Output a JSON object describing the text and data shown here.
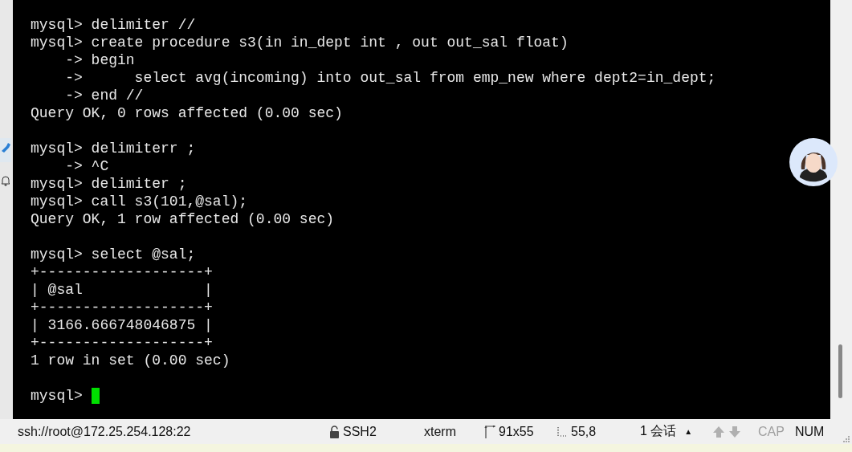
{
  "terminal": {
    "blocks": [
      {
        "lines": [
          "mysql> delimiter //",
          "mysql> create procedure s3(in in_dept int , out out_sal float)",
          "    -> begin",
          "    ->      select avg(incoming) into out_sal from emp_new where dept2=in_dept;",
          "    -> end //",
          "Query OK, 0 rows affected (0.00 sec)"
        ]
      },
      {
        "lines": [
          "mysql> delimiterr ;",
          "    -> ^C",
          "mysql> delimiter ;",
          "mysql> call s3(101,@sal);",
          "Query OK, 1 row affected (0.00 sec)"
        ]
      },
      {
        "lines": [
          "mysql> select @sal;",
          "+-------------------+",
          "| @sal              |",
          "+-------------------+",
          "| 3166.666748046875 |",
          "+-------------------+",
          "1 row in set (0.00 sec)"
        ]
      },
      {
        "lines": [
          "mysql>"
        ],
        "cursor": true
      }
    ]
  },
  "status_bar": {
    "items": [
      {
        "kind": "text",
        "text": "ssh://root@172.25.254.128:22",
        "disabled": false
      },
      {
        "kind": "lock",
        "text": "SSH2",
        "disabled": false
      },
      {
        "kind": "text",
        "text": "xterm",
        "disabled": false
      },
      {
        "kind": "size",
        "text": "91x55",
        "disabled": false
      },
      {
        "kind": "pos",
        "text": "55,8",
        "disabled": false
      },
      {
        "kind": "sessions",
        "text": "1 会话",
        "caret": "▲",
        "disabled": false
      },
      {
        "kind": "arrows",
        "disabled": true
      },
      {
        "kind": "text",
        "text": "CAP",
        "disabled": true
      },
      {
        "kind": "text",
        "text": "NUM",
        "disabled": false
      }
    ]
  }
}
